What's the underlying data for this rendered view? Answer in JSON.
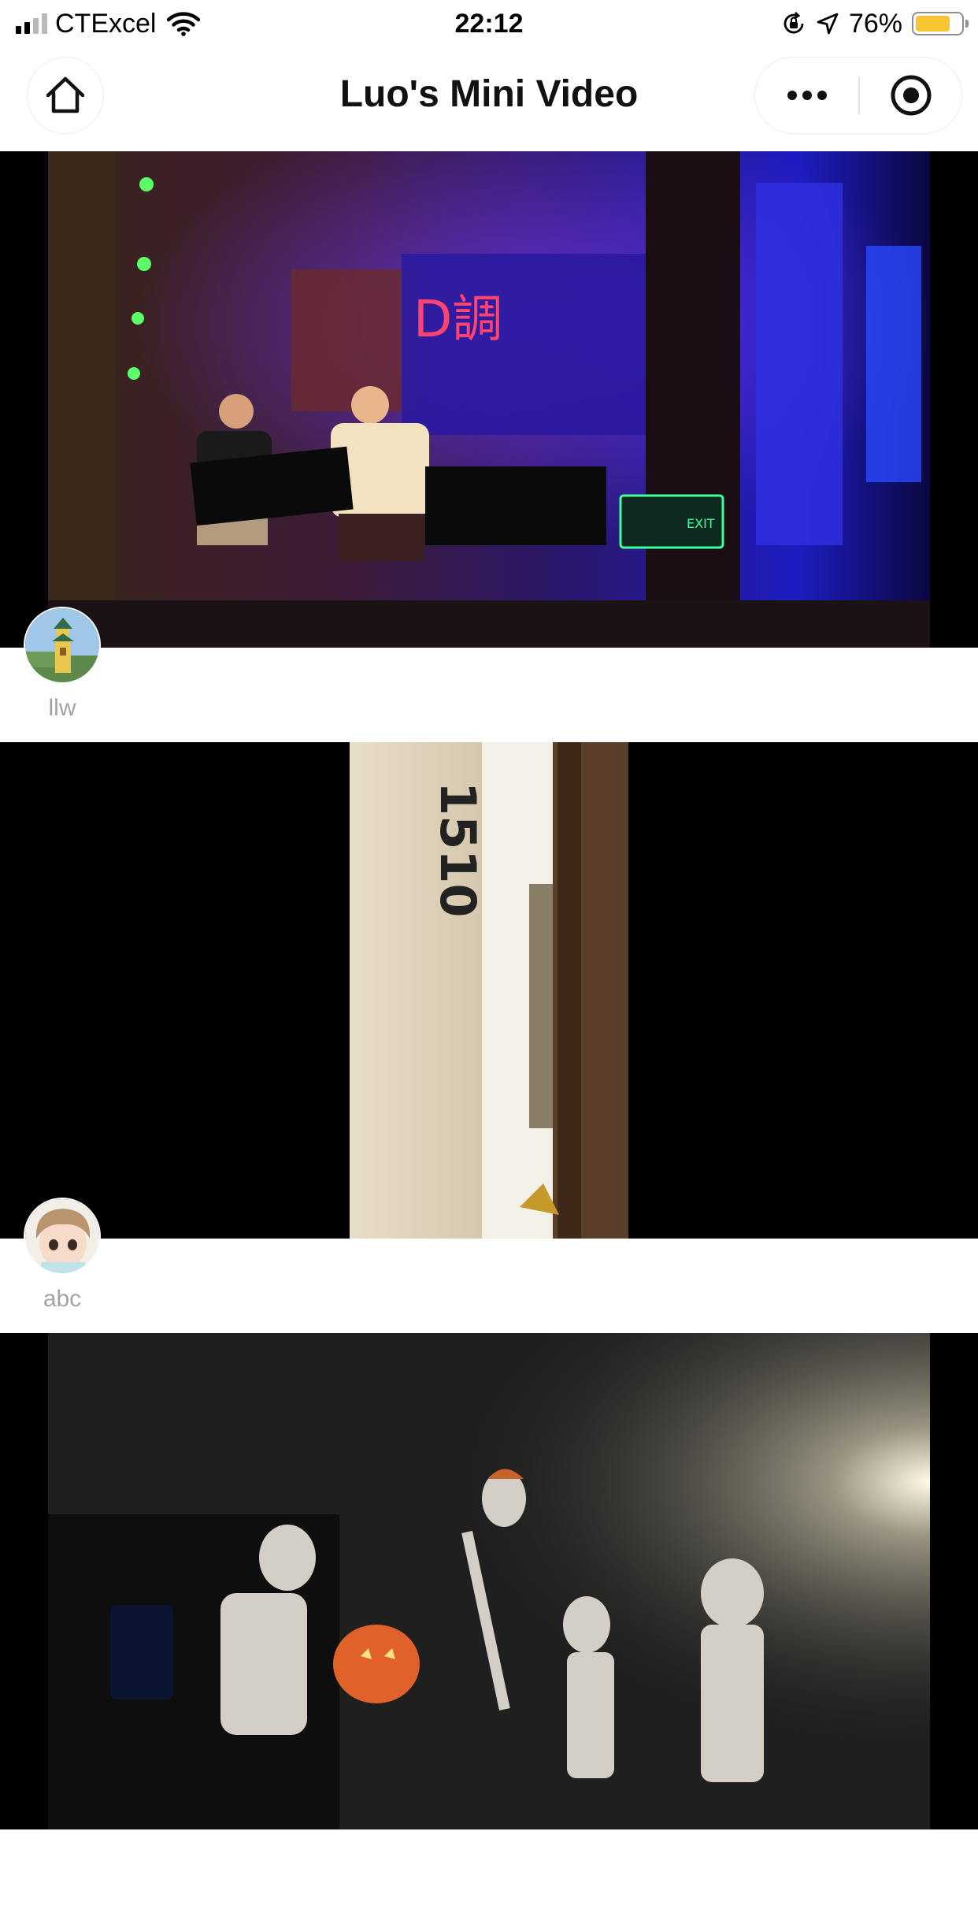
{
  "status_bar": {
    "carrier": "CTExcel",
    "time": "22:12",
    "battery_percent": "76%",
    "battery_level": 0.76,
    "signal_bars_active": 2,
    "signal_bars_total": 4
  },
  "nav": {
    "title": "Luo's Mini Video",
    "home_icon": "home-icon",
    "more_icon": "more-dots-icon",
    "close_icon": "target-icon"
  },
  "feed": [
    {
      "author": "llw",
      "avatar": "pagoda-avatar",
      "video": "live music stage at bar"
    },
    {
      "author": "abc",
      "avatar": "anime-boy-avatar",
      "video": "door with number 1510"
    },
    {
      "author": "",
      "avatar": "",
      "video": "halloween skeleton decorations at night"
    }
  ],
  "video2_text": {
    "door_number": "1510"
  },
  "video1_text": {
    "sign_text": "D調",
    "exit_text": "EXIT"
  },
  "colors": {
    "battery": "#f7c531",
    "author_name": "#a3a3a3",
    "background": "#ffffff"
  }
}
